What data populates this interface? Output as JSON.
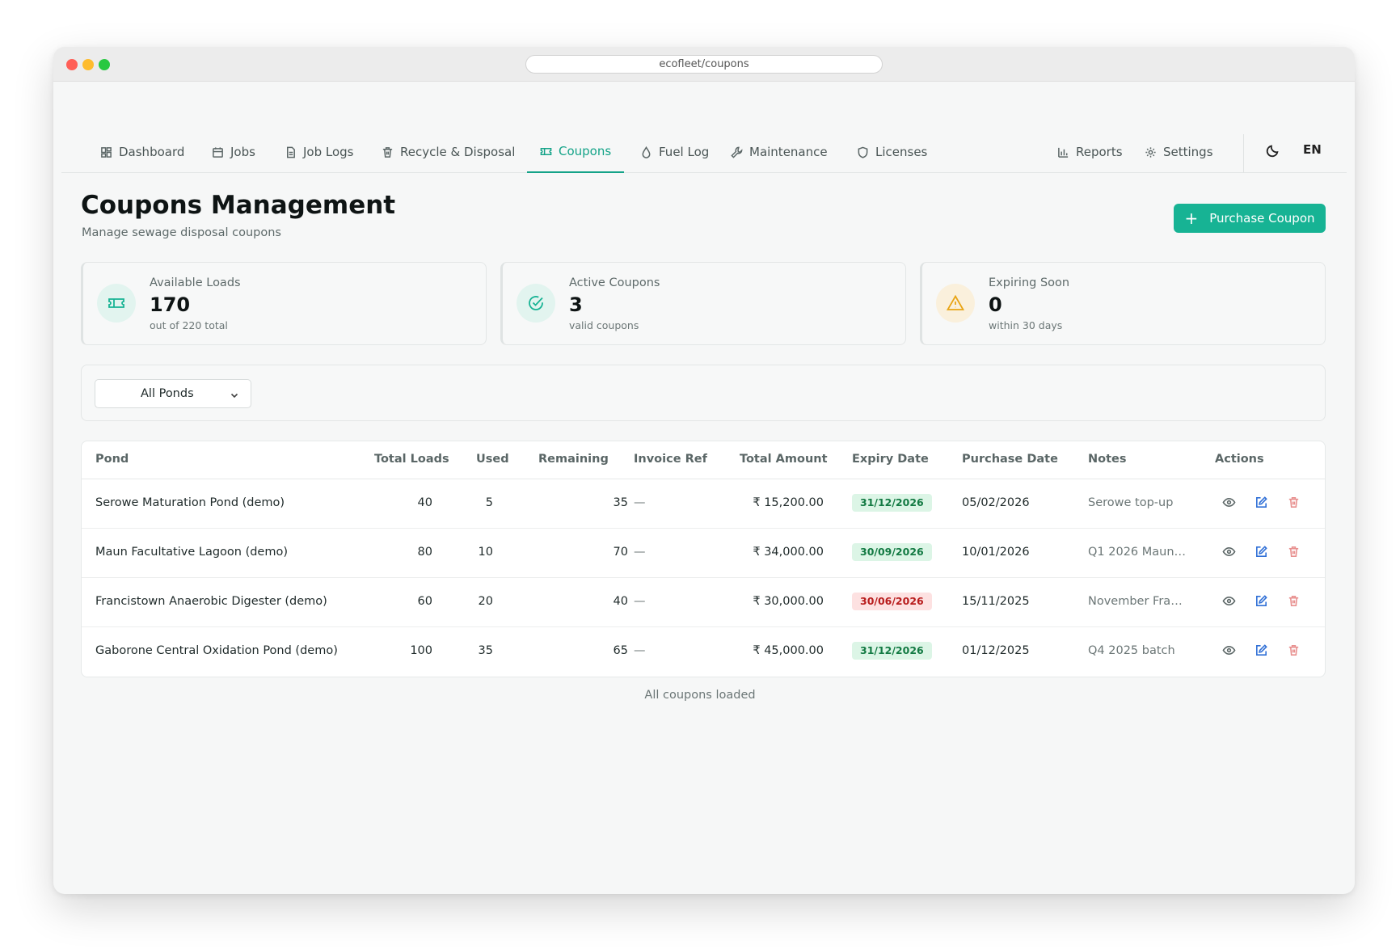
{
  "window": {
    "url": "ecofleet/coupons"
  },
  "nav": {
    "items": [
      {
        "label": "Dashboard",
        "icon": "dashboard-icon"
      },
      {
        "label": "Jobs",
        "icon": "calendar-icon"
      },
      {
        "label": "Job Logs",
        "icon": "document-icon"
      },
      {
        "label": "Recycle & Disposal",
        "icon": "trash-icon"
      },
      {
        "label": "Coupons",
        "icon": "ticket-icon",
        "active": true
      },
      {
        "label": "Fuel Log",
        "icon": "droplet-icon"
      },
      {
        "label": "Maintenance",
        "icon": "wrench-icon"
      },
      {
        "label": "Licenses",
        "icon": "shield-icon"
      }
    ],
    "right_items": [
      {
        "label": "Reports",
        "icon": "bar-chart-icon"
      },
      {
        "label": "Settings",
        "icon": "gear-icon"
      }
    ],
    "theme_icon": "moon-icon",
    "language": "EN"
  },
  "header": {
    "title": "Coupons Management",
    "subtitle": "Manage sewage disposal coupons",
    "primary_action": "Purchase Coupon"
  },
  "stats": [
    {
      "label": "Available Loads",
      "value": "170",
      "sub": "out of 220 total",
      "icon": "ticket-icon",
      "color": "#17b394"
    },
    {
      "label": "Active Coupons",
      "value": "3",
      "sub": "valid coupons",
      "icon": "check-circle-icon",
      "color": "#17b394"
    },
    {
      "label": "Expiring Soon",
      "value": "0",
      "sub": "within 30 days",
      "icon": "warning-icon",
      "color": "#e8a415"
    }
  ],
  "filter": {
    "selected": "All Ponds"
  },
  "table": {
    "columns": [
      "Pond",
      "Total Loads",
      "Used",
      "Remaining",
      "Invoice Ref",
      "Total Amount",
      "Expiry Date",
      "Purchase Date",
      "Notes",
      "Actions"
    ],
    "rows": [
      {
        "pond": "Serowe Maturation Pond (demo)",
        "total": "40",
        "used": "5",
        "remaining": "35",
        "invoice": "—",
        "amount": "₹ 15,200.00",
        "expiry": "31/12/2026",
        "expiry_status": "valid",
        "purchase": "05/02/2026",
        "notes": "Serowe top-up"
      },
      {
        "pond": "Maun Facultative Lagoon (demo)",
        "total": "80",
        "used": "10",
        "remaining": "70",
        "invoice": "—",
        "amount": "₹ 34,000.00",
        "expiry": "30/09/2026",
        "expiry_status": "valid",
        "purchase": "10/01/2026",
        "notes": "Q1 2026 Maun ..."
      },
      {
        "pond": "Francistown Anaerobic Digester (demo)",
        "total": "60",
        "used": "20",
        "remaining": "40",
        "invoice": "—",
        "amount": "₹ 30,000.00",
        "expiry": "30/06/2026",
        "expiry_status": "warning",
        "purchase": "15/11/2025",
        "notes": "November Fran..."
      },
      {
        "pond": "Gaborone Central Oxidation Pond (demo)",
        "total": "100",
        "used": "35",
        "remaining": "65",
        "invoice": "—",
        "amount": "₹ 45,000.00",
        "expiry": "31/12/2026",
        "expiry_status": "valid",
        "purchase": "01/12/2025",
        "notes": "Q4 2025 batch"
      }
    ]
  },
  "footer": {
    "status": "All coupons loaded"
  },
  "colors": {
    "accent": "#17b394",
    "view": "#5b6666",
    "edit": "#2f6fd6",
    "delete": "#e8908f"
  }
}
